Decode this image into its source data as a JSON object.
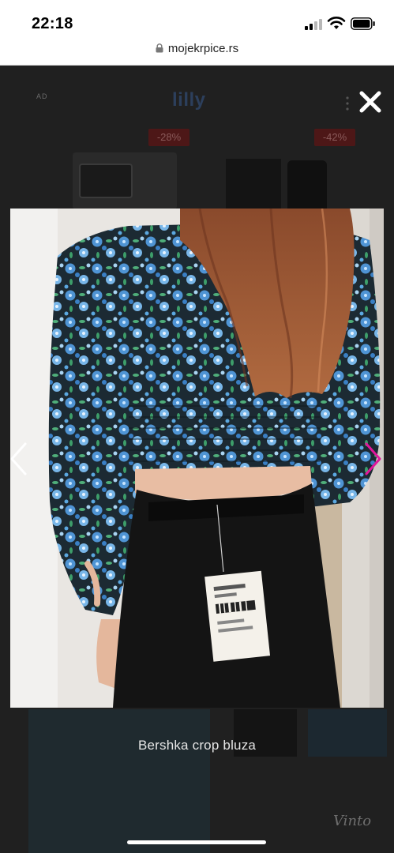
{
  "status": {
    "time": "22:18"
  },
  "browser": {
    "url": "mojekrpice.rs"
  },
  "ad": {
    "label": "AD",
    "brand": "lilly",
    "discounts": [
      "-28%",
      "-42%"
    ]
  },
  "lightbox": {
    "caption": "Bershka crop bluza",
    "close_icon": "close-icon",
    "prev_icon": "chevron-left-icon",
    "next_icon": "chevron-right-icon",
    "accent": "#e0169b"
  },
  "watermark": "Vinto"
}
